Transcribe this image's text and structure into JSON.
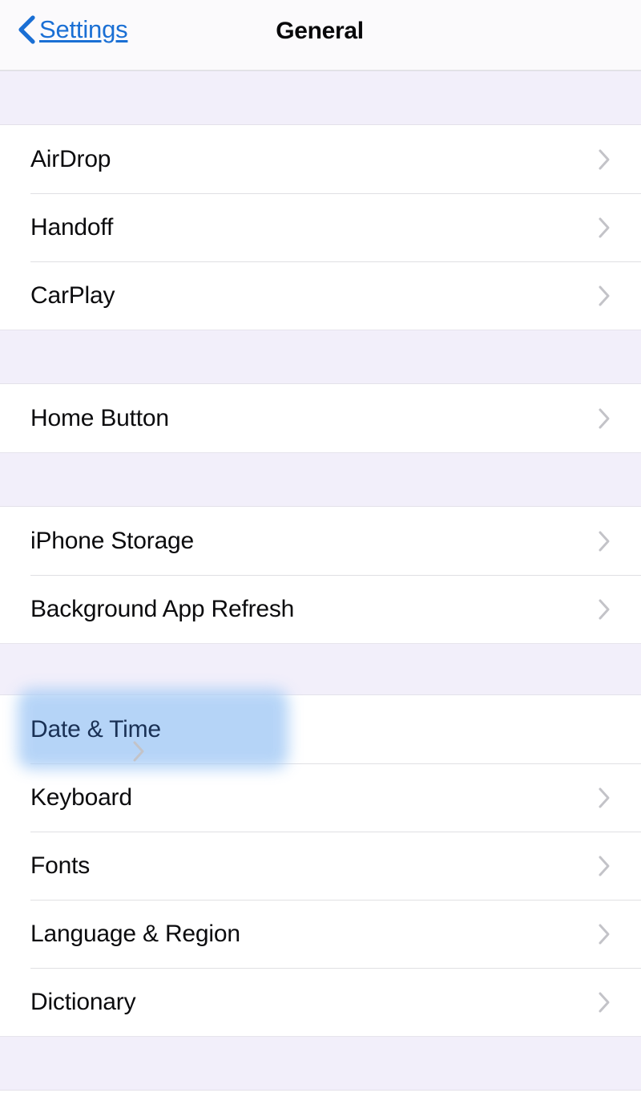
{
  "navbar": {
    "back_label": "Settings",
    "back_icon": "chevron-left-icon",
    "title": "General",
    "accent_color": "#1a6fd4",
    "title_color": "#08080a",
    "background": "#fbfafc"
  },
  "theme": {
    "list_background": "#ffffff",
    "gap_background": "#f2effa",
    "separator_color": "#e0e0e3",
    "chevron_color": "#c3c3c8",
    "highlight_color": "#a9cdf6",
    "highlighted_text_color": "#243b58"
  },
  "sections": [
    {
      "id": "sharing",
      "gap_height": 68,
      "rows": [
        {
          "label": "AirDrop",
          "accessory": "chevron-right-icon",
          "highlighted": false
        },
        {
          "label": "Handoff",
          "accessory": "chevron-right-icon",
          "highlighted": false
        },
        {
          "label": "CarPlay",
          "accessory": "chevron-right-icon",
          "highlighted": false
        }
      ]
    },
    {
      "id": "home-button",
      "gap_height": 68,
      "rows": [
        {
          "label": "Home Button",
          "accessory": "chevron-right-icon",
          "highlighted": false
        }
      ]
    },
    {
      "id": "storage",
      "gap_height": 68,
      "rows": [
        {
          "label": "iPhone Storage",
          "accessory": "chevron-right-icon",
          "highlighted": false
        },
        {
          "label": "Background App Refresh",
          "accessory": "chevron-right-icon",
          "highlighted": false
        }
      ]
    },
    {
      "id": "localization",
      "gap_height": 65,
      "rows": [
        {
          "label": "Date & Time",
          "accessory": "chevron-right-icon",
          "highlighted": true
        },
        {
          "label": "Keyboard",
          "accessory": "chevron-right-icon",
          "highlighted": false
        },
        {
          "label": "Fonts",
          "accessory": "chevron-right-icon",
          "highlighted": false
        },
        {
          "label": "Language & Region",
          "accessory": "chevron-right-icon",
          "highlighted": false
        },
        {
          "label": "Dictionary",
          "accessory": "chevron-right-icon",
          "highlighted": false
        }
      ]
    }
  ],
  "footer": {
    "gap_height": 68
  }
}
